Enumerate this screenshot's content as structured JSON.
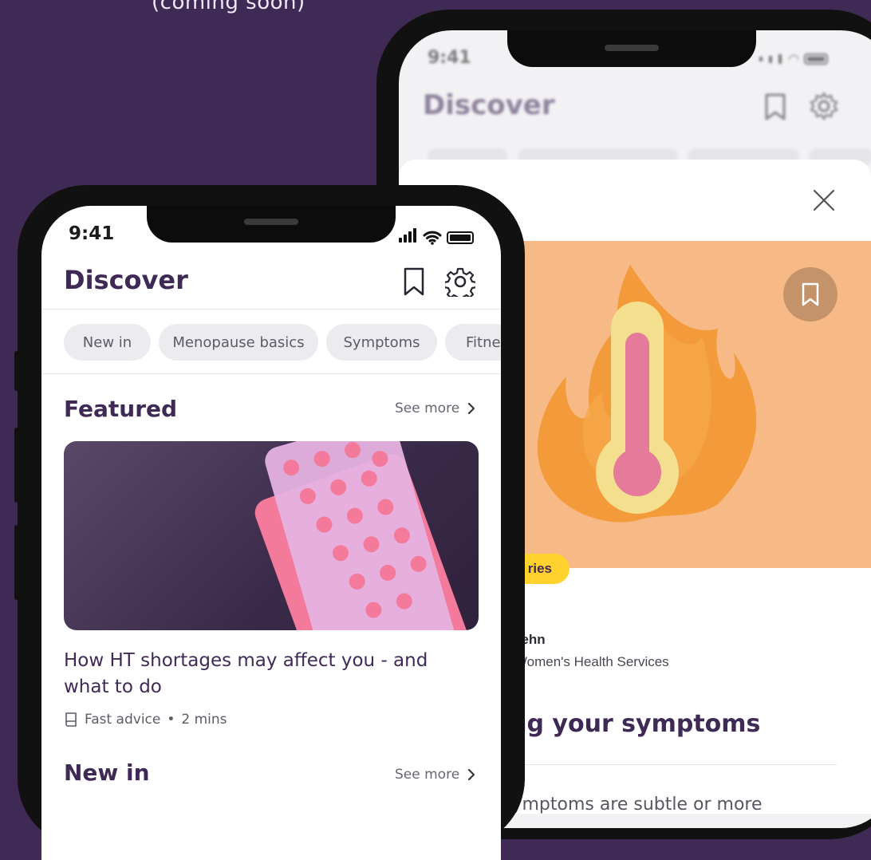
{
  "caption": "(coming soon)",
  "back_phone": {
    "status": {
      "time": "9:41"
    },
    "header": {
      "title": "Discover"
    },
    "sheet": {
      "badge": "ries",
      "author": {
        "name": "o Dehn",
        "role": "of Women's Health Services"
      },
      "section_title": "Mana    ng your symptoms",
      "body_text": "ur symptoms are subtle or more"
    },
    "colors": {
      "hero_bg": "#f7b986",
      "badge_bg": "#ffd22e"
    }
  },
  "front_phone": {
    "status": {
      "time": "9:41"
    },
    "header": {
      "title": "Discover",
      "icons": [
        "bookmark-icon",
        "gear-icon"
      ]
    },
    "chips": [
      "New in",
      "Menopause basics",
      "Symptoms",
      "Fitnes"
    ],
    "featured": {
      "title": "Featured",
      "see_more": "See more",
      "article": {
        "title": "How HT shortages may affect you - and what to do",
        "type": "Fast advice",
        "separator": "•",
        "duration": "2 mins"
      }
    },
    "new_in": {
      "title": "New in",
      "see_more": "See more"
    }
  },
  "colors": {
    "background": "#3f2a56",
    "brand": "#3f2a56",
    "chip_bg": "#ecebef",
    "pill_pink": "#f47a9c"
  }
}
